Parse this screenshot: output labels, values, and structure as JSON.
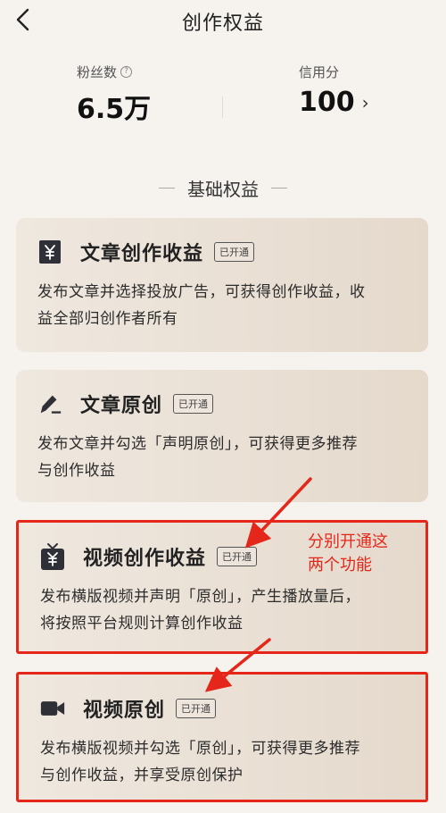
{
  "header": {
    "title": "创作权益",
    "back_icon": "chevron-left-icon"
  },
  "stats": {
    "fans": {
      "label": "粉丝数",
      "value": "6.5万",
      "info_icon": "info-icon",
      "info_glyph": "?"
    },
    "credit": {
      "label": "信用分",
      "value": "100",
      "chevron": "›"
    }
  },
  "section": {
    "title": "基础权益"
  },
  "cards": [
    {
      "icon": "yuan-square-icon",
      "title": "文章创作收益",
      "badge": "已开通",
      "desc_line1": "发布文章并选择投放广告，可获得创作收益，收",
      "desc_line2": "益全部归创作者所有"
    },
    {
      "icon": "pen-icon",
      "title": "文章原创",
      "badge": "已开通",
      "desc_line1": "发布文章并勾选「声明原创」，可获得更多推荐",
      "desc_line2": "与创作收益"
    },
    {
      "icon": "tv-yuan-icon",
      "title": "视频创作收益",
      "badge": "已开通",
      "desc_line1": "发布横版视频并声明「原创」，产生播放量后，",
      "desc_line2": "将按照平台规则计算创作收益"
    },
    {
      "icon": "video-camera-icon",
      "title": "视频原创",
      "badge": "已开通",
      "desc_line1": "发布横版视频并勾选「原创」，可获得更多推荐",
      "desc_line2": "与创作收益，并享受原创保护"
    }
  ],
  "annotation": {
    "line1": "分别开通这",
    "line2": "两个功能",
    "color": "#e4271a"
  },
  "colors": {
    "background": "#f6f3ef",
    "card_gradient_start": "#efe8df",
    "card_gradient_end": "#e5d9cc",
    "highlight": "#e4271a"
  }
}
